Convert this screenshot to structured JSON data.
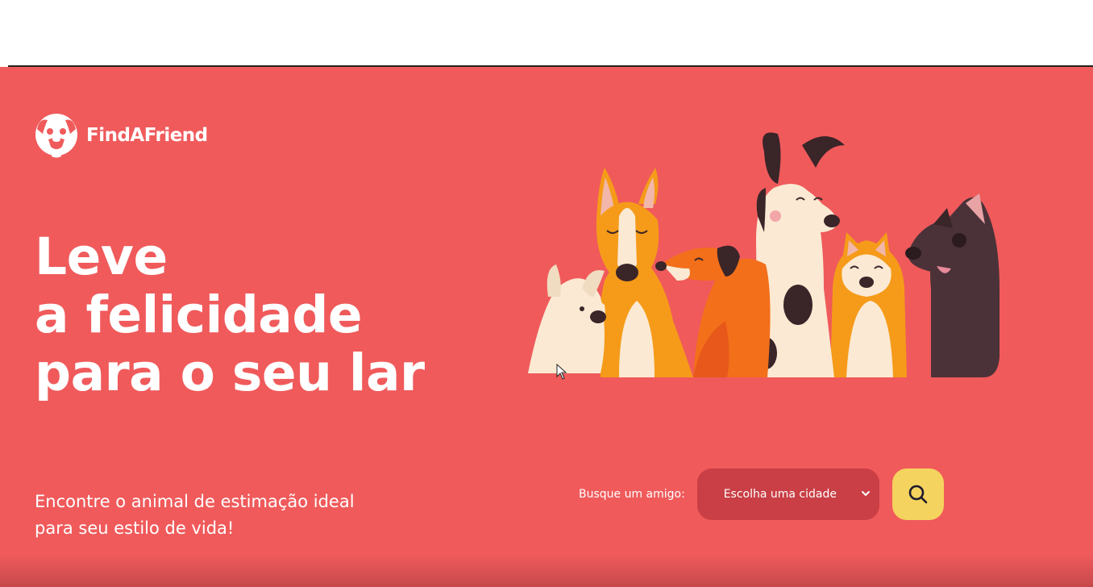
{
  "brand": {
    "name": "FindAFriend"
  },
  "hero": {
    "headline": [
      "Leve",
      "a felicidade",
      "para o seu lar"
    ],
    "subtitle": [
      "Encontre o animal de estimação ideal",
      "para seu estilo de vida!"
    ]
  },
  "search": {
    "label": "Busque um amigo:",
    "city_select_value": "Escolha uma cidade"
  },
  "icons": {
    "logo": "dog-face-icon",
    "select_arrow": "chevron-down-icon",
    "search": "search-icon"
  },
  "colors": {
    "background": "#f05a5b",
    "select_bg": "#c93f45",
    "search_button": "#f4d35e",
    "text": "#ffffff"
  }
}
